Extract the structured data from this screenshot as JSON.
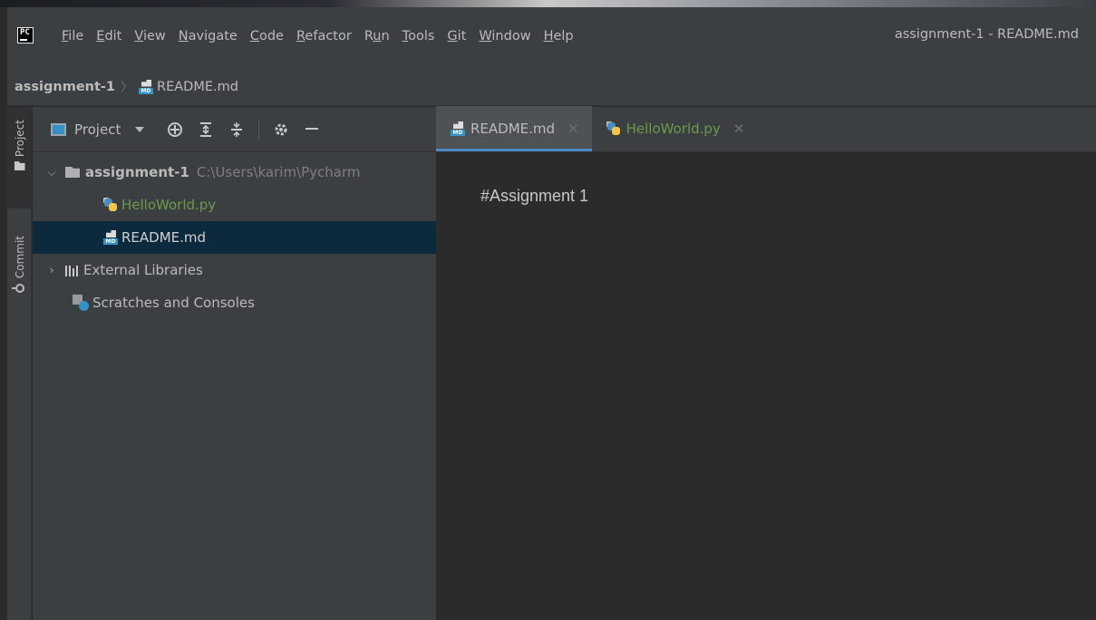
{
  "window": {
    "title": "assignment-1 - README.md",
    "app_logo": "PC"
  },
  "menu": [
    {
      "pre": "",
      "mnemonic": "F",
      "post": "ile"
    },
    {
      "pre": "",
      "mnemonic": "E",
      "post": "dit"
    },
    {
      "pre": "",
      "mnemonic": "V",
      "post": "iew"
    },
    {
      "pre": "",
      "mnemonic": "N",
      "post": "avigate"
    },
    {
      "pre": "",
      "mnemonic": "C",
      "post": "ode"
    },
    {
      "pre": "",
      "mnemonic": "R",
      "post": "efactor"
    },
    {
      "pre": "R",
      "mnemonic": "u",
      "post": "n"
    },
    {
      "pre": "",
      "mnemonic": "T",
      "post": "ools"
    },
    {
      "pre": "",
      "mnemonic": "G",
      "post": "it"
    },
    {
      "pre": "",
      "mnemonic": "W",
      "post": "indow"
    },
    {
      "pre": "",
      "mnemonic": "H",
      "post": "elp"
    }
  ],
  "breadcrumb": {
    "project": "assignment-1",
    "file": "README.md"
  },
  "side_tabs": {
    "project": "Project",
    "commit": "Commit"
  },
  "project_panel": {
    "title": "Project",
    "toolbar_icons": [
      "locate-icon",
      "expand-all-icon",
      "collapse-all-icon",
      "gear-icon",
      "hide-icon"
    ],
    "tree": {
      "root_name": "assignment-1",
      "root_path": "C:\\Users\\karim\\Pycharm",
      "file_py": "HelloWorld.py",
      "file_md": "README.md",
      "external_libraries": "External Libraries",
      "scratches": "Scratches and Consoles"
    }
  },
  "editor": {
    "tabs": [
      {
        "label": "README.md",
        "icon": "markdown-icon",
        "active": true
      },
      {
        "label": "HelloWorld.py",
        "icon": "python-icon",
        "active": false
      }
    ],
    "content": "#Assignment 1"
  },
  "colors": {
    "accent": "#4a88c7",
    "selection": "#0d293e",
    "python_file_text": "#6a9a4a"
  }
}
